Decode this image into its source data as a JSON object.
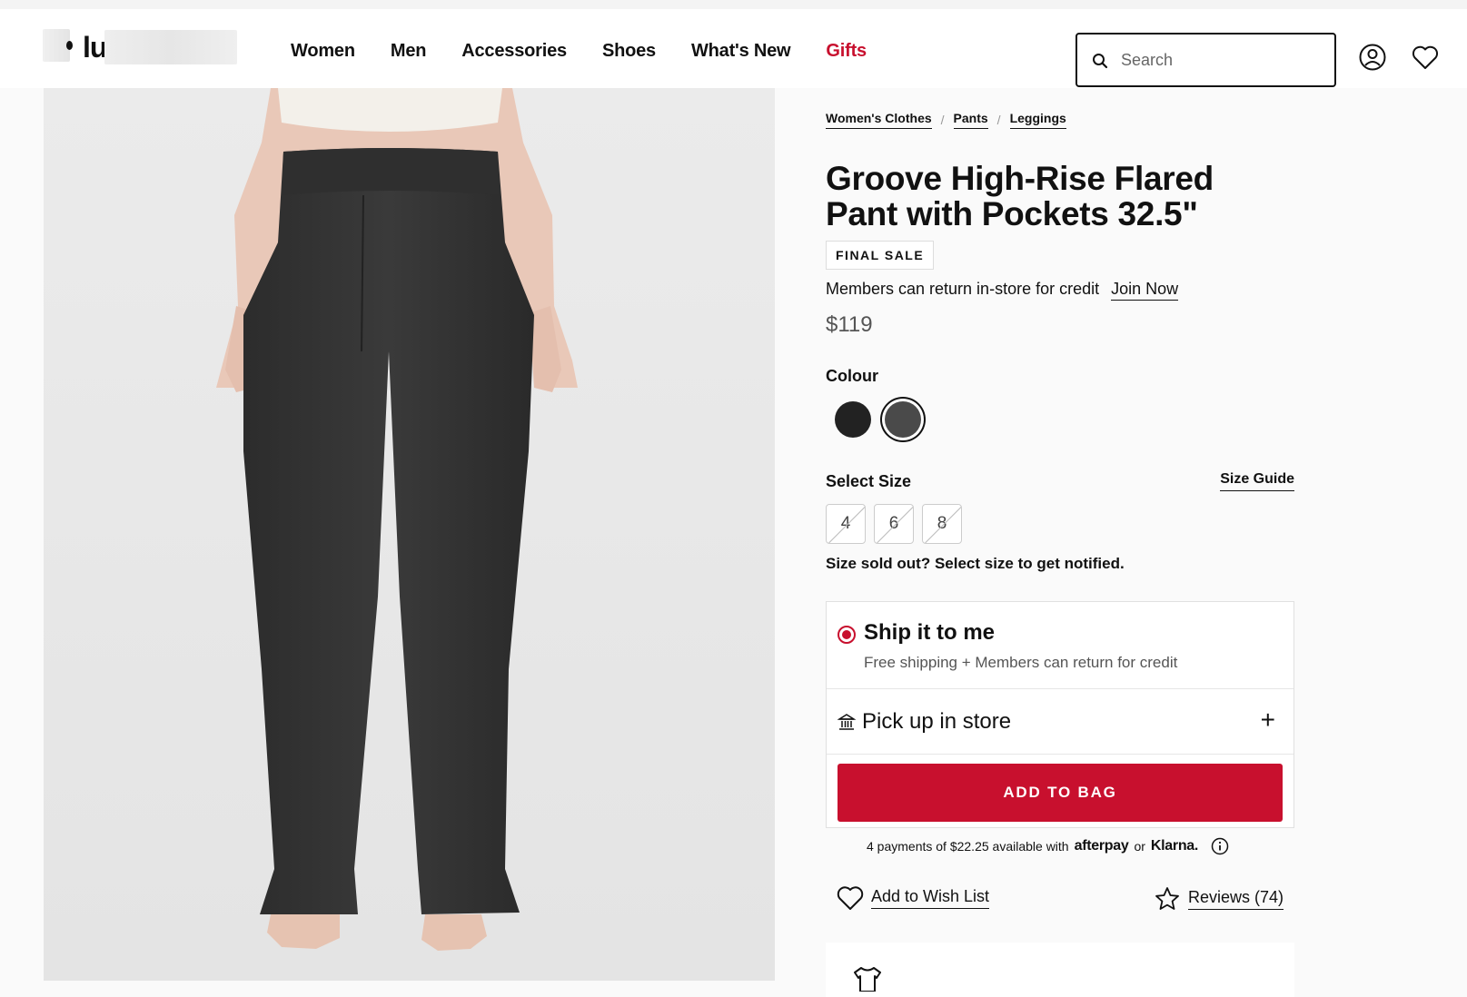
{
  "header": {
    "logo_text": "lu",
    "nav": [
      "Women",
      "Men",
      "Accessories",
      "Shoes",
      "What's New",
      "Gifts"
    ],
    "search_placeholder": "Search",
    "accent_color": "#c8102e"
  },
  "icons": [
    "search-icon",
    "account-icon",
    "wishlist-heart-icon",
    "store-icon",
    "plus-icon",
    "heart-icon",
    "star-icon",
    "info-icon",
    "shirt-icon"
  ],
  "breadcrumb": [
    "Women's Clothes",
    "Pants",
    "Leggings"
  ],
  "product": {
    "title": "Groove High-Rise Flared Pant with Pockets 32.5\"",
    "badge": "FINAL SALE",
    "members_text": "Members can return in-store for credit",
    "join_label": "Join Now",
    "price": "$119"
  },
  "colour": {
    "label": "Colour",
    "swatches": [
      "#222222",
      "#4a4a4a"
    ],
    "selected_index": 1
  },
  "size": {
    "label": "Select Size",
    "guide_label": "Size Guide",
    "options": [
      "4",
      "6",
      "8"
    ],
    "sold_out_text": "Size sold out? Select size to get notified."
  },
  "fulfilment": {
    "ship_title": "Ship it to me",
    "ship_sub": "Free shipping + Members can return for credit",
    "pickup_title": "Pick up in store",
    "add_to_bag": "ADD TO BAG"
  },
  "payments": {
    "text": "4 payments of $22.25 available with",
    "brand1": "afterpay",
    "or": "or",
    "brand2": "Klarna."
  },
  "actions": {
    "wishlist": "Add to Wish List",
    "reviews": "Reviews (74)"
  }
}
